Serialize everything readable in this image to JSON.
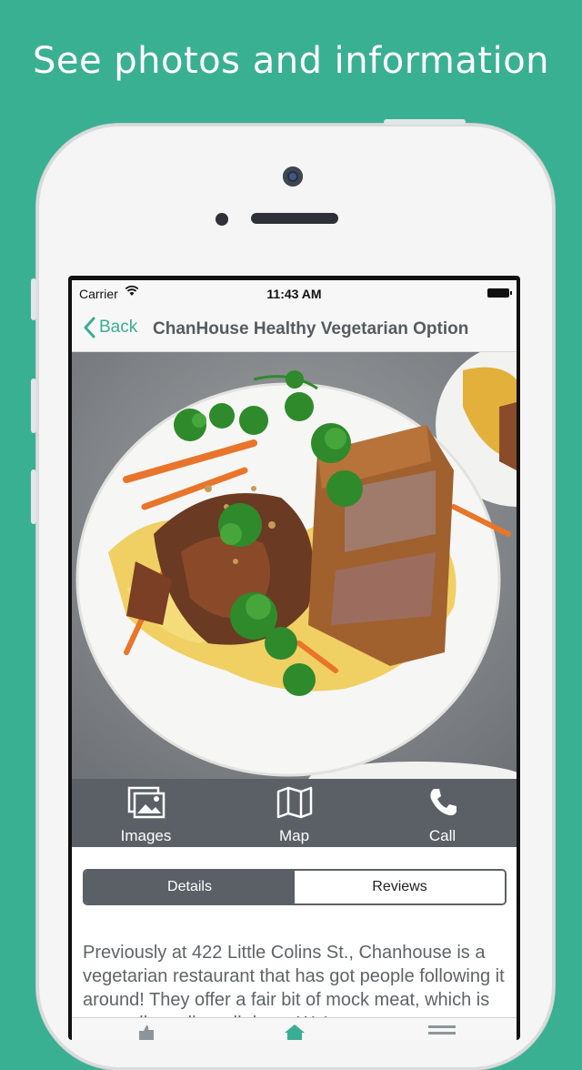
{
  "headline": "See photos and information",
  "status": {
    "carrier": "Carrier",
    "time": "11:43 AM"
  },
  "nav": {
    "back_label": "Back",
    "title": "ChanHouse Healthy Vegetarian Option"
  },
  "actions": [
    {
      "label": "Images",
      "icon": "images-icon"
    },
    {
      "label": "Map",
      "icon": "map-icon"
    },
    {
      "label": "Call",
      "icon": "phone-icon"
    }
  ],
  "segments": [
    {
      "label": "Details",
      "selected": true
    },
    {
      "label": "Reviews",
      "selected": false
    }
  ],
  "description": "Previously at 422 Little Colins St., Chanhouse is a vegetarian restaurant that has got people following it around!  They offer a fair bit of mock meat, which is generally really well done. We've",
  "colors": {
    "background": "#3ab093",
    "accent": "#3aae93",
    "bar": "#5a6066"
  }
}
